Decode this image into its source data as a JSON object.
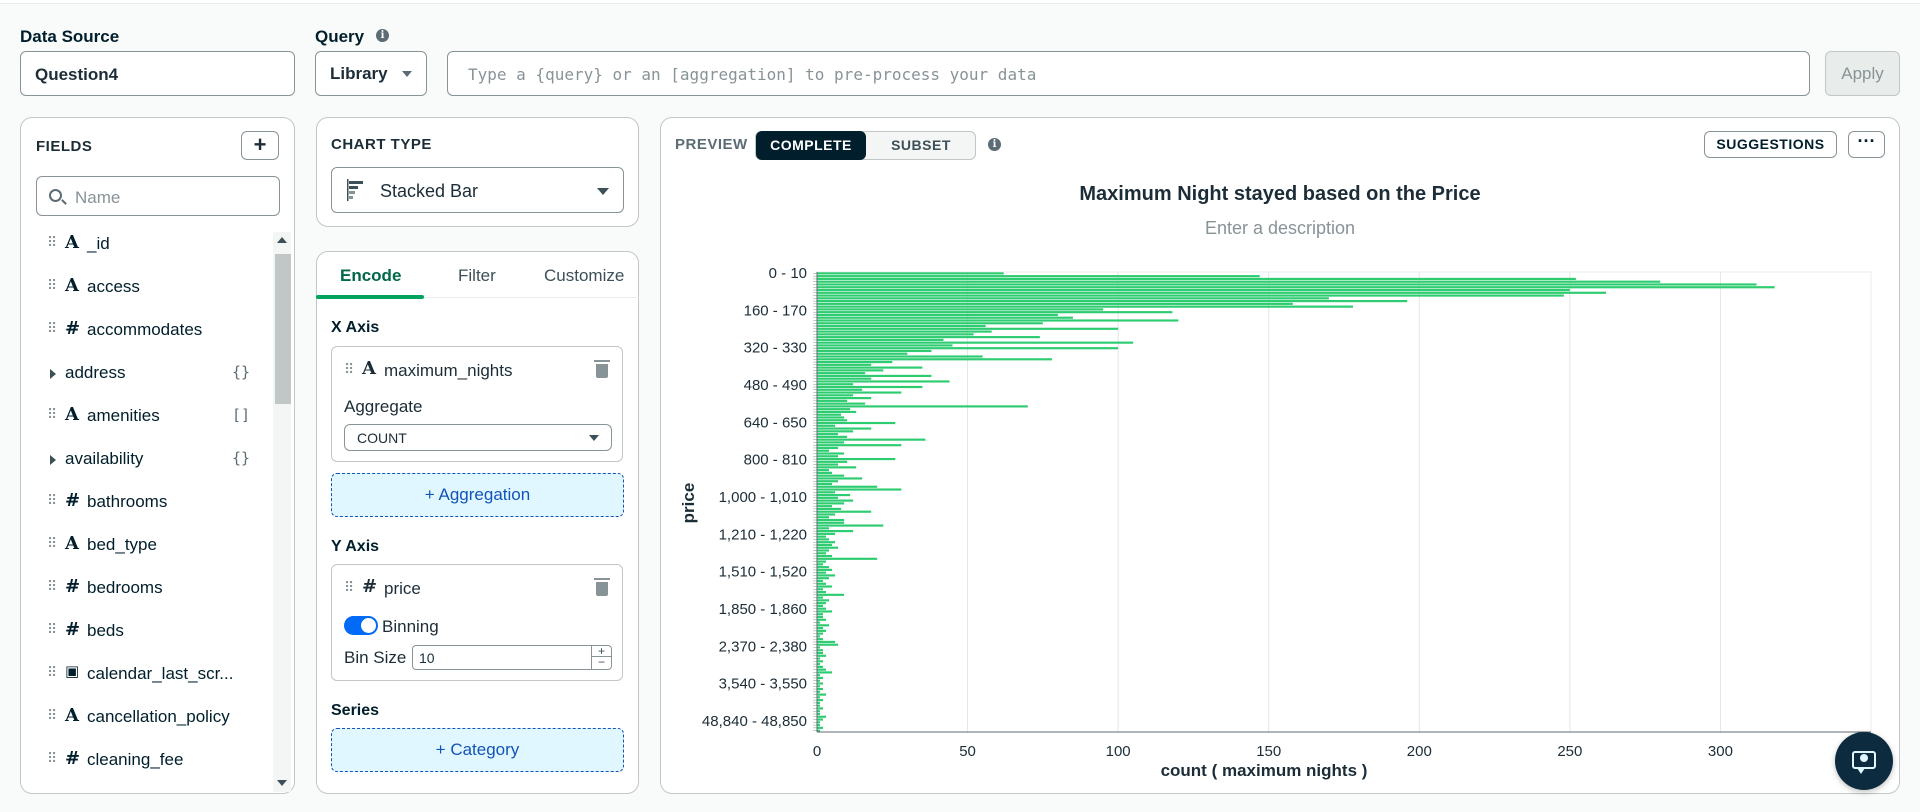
{
  "data_source": {
    "label": "Data Source",
    "value": "Question4"
  },
  "query": {
    "label": "Query",
    "mode": "Library",
    "placeholder": "Type a {query} or an [aggregation] to pre-process your data",
    "apply_label": "Apply"
  },
  "fields_panel": {
    "title": "FIELDS",
    "add_label": "+",
    "search_placeholder": "Name",
    "items": [
      {
        "type": "A",
        "name": "_id",
        "badge": ""
      },
      {
        "type": "A",
        "name": "access",
        "badge": ""
      },
      {
        "type": "#",
        "name": "accommodates",
        "badge": ""
      },
      {
        "type": "expand",
        "name": "address",
        "badge": "{}"
      },
      {
        "type": "A",
        "name": "amenities",
        "badge": "[]"
      },
      {
        "type": "expand",
        "name": "availability",
        "badge": "{}"
      },
      {
        "type": "#",
        "name": "bathrooms",
        "badge": ""
      },
      {
        "type": "A",
        "name": "bed_type",
        "badge": ""
      },
      {
        "type": "#",
        "name": "bedrooms",
        "badge": ""
      },
      {
        "type": "#",
        "name": "beds",
        "badge": ""
      },
      {
        "type": "date",
        "name": "calendar_last_scr...",
        "badge": ""
      },
      {
        "type": "A",
        "name": "cancellation_policy",
        "badge": ""
      },
      {
        "type": "#",
        "name": "cleaning_fee",
        "badge": ""
      }
    ]
  },
  "chart_type": {
    "title": "CHART TYPE",
    "selected": "Stacked Bar"
  },
  "encode": {
    "tabs": [
      "Encode",
      "Filter",
      "Customize"
    ],
    "x_axis": {
      "label": "X Axis",
      "field_type": "A",
      "field": "maximum_nights",
      "aggregate_label": "Aggregate",
      "aggregate_value": "COUNT",
      "add_aggregation": "+ Aggregation"
    },
    "y_axis": {
      "label": "Y Axis",
      "field_type": "#",
      "field": "price",
      "binning_label": "Binning",
      "binning_on": true,
      "bin_size_label": "Bin Size",
      "bin_size": "10"
    },
    "series": {
      "label": "Series",
      "add_category": "+ Category"
    }
  },
  "preview": {
    "label": "PREVIEW",
    "mode_complete": "COMPLETE",
    "mode_subset": "SUBSET",
    "suggestions": "SUGGESTIONS",
    "more": "···",
    "chart_title": "Maximum Night stayed based on the Price",
    "chart_description": "Enter a description"
  },
  "colors": {
    "bar": "#2ecc71",
    "accent": "#00a35c",
    "dark": "#001e2b",
    "link": "#1254b7"
  },
  "chart_data": {
    "type": "bar",
    "orientation": "horizontal",
    "title": "Maximum Night stayed based on the Price",
    "xlabel": "count ( maximum  nights )",
    "ylabel": "price",
    "xlim": [
      0,
      350
    ],
    "x_ticks": [
      0,
      50,
      100,
      150,
      200,
      250,
      300
    ],
    "y_tick_labels": [
      "0 - 10",
      "160 - 170",
      "320 - 330",
      "480 - 490",
      "640 - 650",
      "800 - 810",
      "1,000 - 1,010",
      "1,210 - 1,220",
      "1,510 - 1,520",
      "1,850 - 1,860",
      "2,370 - 2,380",
      "3,540 - 3,550",
      "48,840 - 48,850"
    ],
    "values": [
      62,
      147,
      252,
      280,
      312,
      318,
      250,
      262,
      248,
      170,
      196,
      158,
      178,
      95,
      118,
      80,
      85,
      120,
      75,
      56,
      100,
      58,
      52,
      74,
      42,
      105,
      45,
      100,
      38,
      30,
      55,
      78,
      25,
      18,
      35,
      22,
      16,
      38,
      18,
      44,
      12,
      35,
      15,
      28,
      12,
      18,
      10,
      16,
      70,
      11,
      13,
      8,
      9,
      10,
      26,
      6,
      18,
      12,
      7,
      10,
      36,
      9,
      28,
      7,
      4,
      9,
      7,
      26,
      10,
      7,
      13,
      4,
      5,
      9,
      15,
      7,
      5,
      20,
      28,
      6,
      11,
      7,
      12,
      9,
      5,
      8,
      18,
      6,
      4,
      9,
      9,
      22,
      4,
      12,
      6,
      3,
      4,
      6,
      5,
      7,
      4,
      3,
      5,
      20,
      3,
      2,
      4,
      5,
      3,
      6,
      4,
      2,
      3,
      5,
      2,
      3,
      9,
      2,
      4,
      3,
      2,
      3,
      5,
      2,
      2,
      3,
      1,
      4,
      2,
      3,
      2,
      1,
      2,
      6,
      7,
      1,
      2,
      2,
      3,
      1,
      2,
      1,
      2,
      3,
      5,
      1,
      2,
      1,
      2,
      1,
      2,
      1,
      3,
      1,
      2,
      1,
      1,
      2,
      1,
      1,
      3,
      2,
      1,
      1,
      2,
      1
    ]
  }
}
